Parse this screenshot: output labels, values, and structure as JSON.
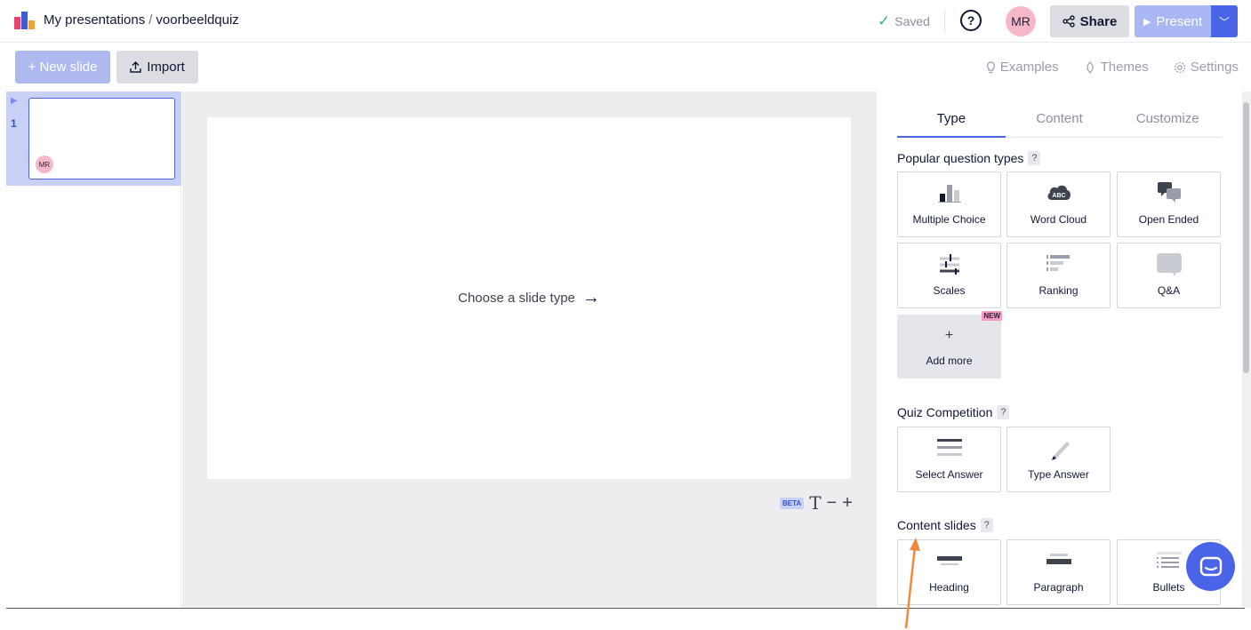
{
  "header": {
    "breadcrumb_root": "My presentations",
    "breadcrumb_sep": "/",
    "breadcrumb_current": "voorbeeldquiz",
    "saved_label": "Saved",
    "help_label": "?",
    "avatar_initials": "MR",
    "share_label": "Share",
    "present_label": "Present"
  },
  "toolbar": {
    "new_slide_label": "+ New slide",
    "import_label": "Import",
    "examples_label": "Examples",
    "themes_label": "Themes",
    "settings_label": "Settings"
  },
  "sidebar": {
    "slides": [
      {
        "number": "1",
        "avatar": "MR"
      }
    ]
  },
  "canvas": {
    "placeholder": "Choose a slide type",
    "beta_label": "BETA",
    "font_tool": "T",
    "font_minus": "−",
    "font_plus": "+"
  },
  "panel": {
    "tabs": [
      "Type",
      "Content",
      "Customize"
    ],
    "popular_title": "Popular question types",
    "popular": [
      "Multiple Choice",
      "Word Cloud",
      "Open Ended",
      "Scales",
      "Ranking",
      "Q&A"
    ],
    "add_more_label": "Add more",
    "add_more_symbol": "+",
    "new_badge": "NEW",
    "quiz_title": "Quiz Competition",
    "quiz": [
      "Select Answer",
      "Type Answer"
    ],
    "content_title": "Content slides",
    "content": [
      "Heading",
      "Paragraph",
      "Bullets"
    ],
    "qmark": "?",
    "wordcloud_abbr": "ABC"
  },
  "colors": {
    "accent": "#4a64e8",
    "accent_light": "#a9b7f4",
    "annotation_arrow": "#ef8a3c",
    "avatar_pink": "#f4b8c8"
  }
}
